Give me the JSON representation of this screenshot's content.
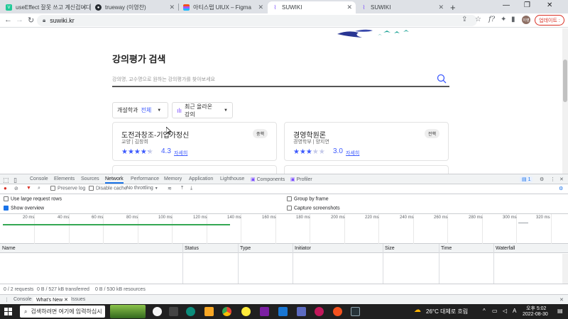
{
  "browser": {
    "tabs": [
      {
        "title": "useEffect 잘못 쓰고 계신겁니다.",
        "icon": "velog-icon",
        "color": "#20c997",
        "active": false
      },
      {
        "title": "trueway (이영찬)",
        "icon": "github-icon",
        "color": "#24292e",
        "active": false
      },
      {
        "title": "아티스탭 UIUX – Figma",
        "icon": "figma-icon",
        "color": "#a259ff",
        "active": false
      },
      {
        "title": "SUWIKI",
        "icon": "suwiki-icon",
        "color": "#7c4dff",
        "active": true
      },
      {
        "title": "SUWIKI",
        "icon": "suwiki-icon",
        "color": "#7c4dff",
        "active": false
      }
    ],
    "url": "suwiki.kr",
    "update_label": "업데이트 :",
    "avatar_label": "이영"
  },
  "page": {
    "title": "강의평가 검색",
    "search_placeholder": "강의명, 교수명으로 원하는 강의평가를 찾아보세요",
    "filter_major_label": "개설학과",
    "filter_major_value": "전체",
    "filter_sort_label": "최근 올라온 강의",
    "cards": [
      {
        "name": "도전과창조-기업가정신",
        "meta": "교양 | 김창희",
        "badge": "중핵",
        "rating": 4.3,
        "rating_text": "4.3",
        "details": "자세히"
      },
      {
        "name": "경영학원론",
        "meta": "경영학부 | 양지연",
        "badge": "전핵",
        "rating": 3.0,
        "rating_text": "3.0",
        "details": "자세히"
      }
    ]
  },
  "devtools": {
    "tabs": [
      "Console",
      "Elements",
      "Sources",
      "Network",
      "Performance",
      "Memory",
      "Application",
      "Lighthouse",
      "Components",
      "Profiler"
    ],
    "active_tab": "Network",
    "issues_count": "1",
    "toolbar": {
      "preserve_log": "Preserve log",
      "disable_cache": "Disable cache",
      "throttling": "No throttling"
    },
    "options": {
      "large_rows": "Use large request rows",
      "show_overview": "Show overview",
      "group_by_frame": "Group by frame",
      "capture_screenshots": "Capture screenshots"
    },
    "timeline_ticks": [
      "20 ms",
      "40 ms",
      "60 ms",
      "80 ms",
      "100 ms",
      "120 ms",
      "140 ms",
      "160 ms",
      "180 ms",
      "200 ms",
      "220 ms",
      "240 ms",
      "260 ms",
      "280 ms",
      "300 ms",
      "320 ms"
    ],
    "columns": [
      "Name",
      "Status",
      "Type",
      "Initiator",
      "Size",
      "Time",
      "Waterfall"
    ],
    "status": {
      "requests": "0 / 2 requests",
      "transferred": "0 B / 527 kB transferred",
      "resources": "0 B / 530 kB resources"
    },
    "drawer_tabs": [
      "Console",
      "What's New",
      "Issues"
    ]
  },
  "taskbar": {
    "search_placeholder": "검색하려면 여기에 입력하십시",
    "weather": "26°C  대체로 흐림",
    "time": "오후 5:02",
    "date": "2022-08-30",
    "ime": "A"
  }
}
